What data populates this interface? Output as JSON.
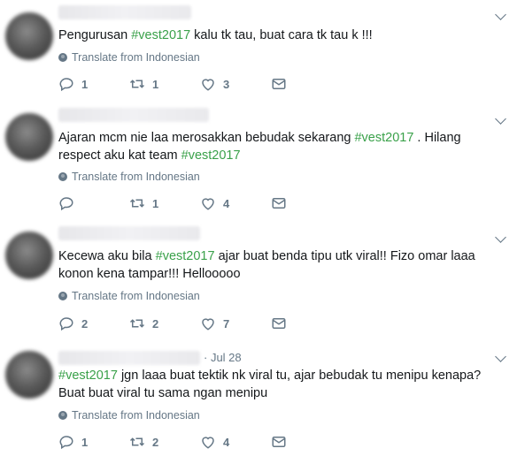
{
  "translate_label": "Translate from Indonesian",
  "tweets": [
    {
      "date": "",
      "text": [
        {
          "t": "Pengurusan ",
          "h": false
        },
        {
          "t": "#vest2017",
          "h": true
        },
        {
          "t": " kalu tk tau, buat cara tk tau k !!!",
          "h": false
        }
      ],
      "reply": "1",
      "retweet": "1",
      "like": "3"
    },
    {
      "date": "",
      "text": [
        {
          "t": "Ajaran mcm nie laa merosakkan bebudak sekarang ",
          "h": false
        },
        {
          "t": "#vest2017",
          "h": true
        },
        {
          "t": " . Hilang respect aku kat team ",
          "h": false
        },
        {
          "t": "#vest2017",
          "h": true
        }
      ],
      "reply": "",
      "retweet": "1",
      "like": "4"
    },
    {
      "date": "",
      "text": [
        {
          "t": "Kecewa aku bila ",
          "h": false
        },
        {
          "t": "#vest2017",
          "h": true
        },
        {
          "t": " ajar buat benda tipu utk viral!! Fizo omar laaa konon kena tampar!!! Hellooooo",
          "h": false
        }
      ],
      "reply": "2",
      "retweet": "2",
      "like": "7"
    },
    {
      "date": "· Jul 28",
      "text": [
        {
          "t": "#vest2017",
          "h": true
        },
        {
          "t": " jgn laaa buat tektik nk viral tu, ajar bebudak tu menipu kenapa? Buat buat viral tu sama ngan menipu",
          "h": false
        }
      ],
      "reply": "1",
      "retweet": "2",
      "like": "4"
    }
  ]
}
